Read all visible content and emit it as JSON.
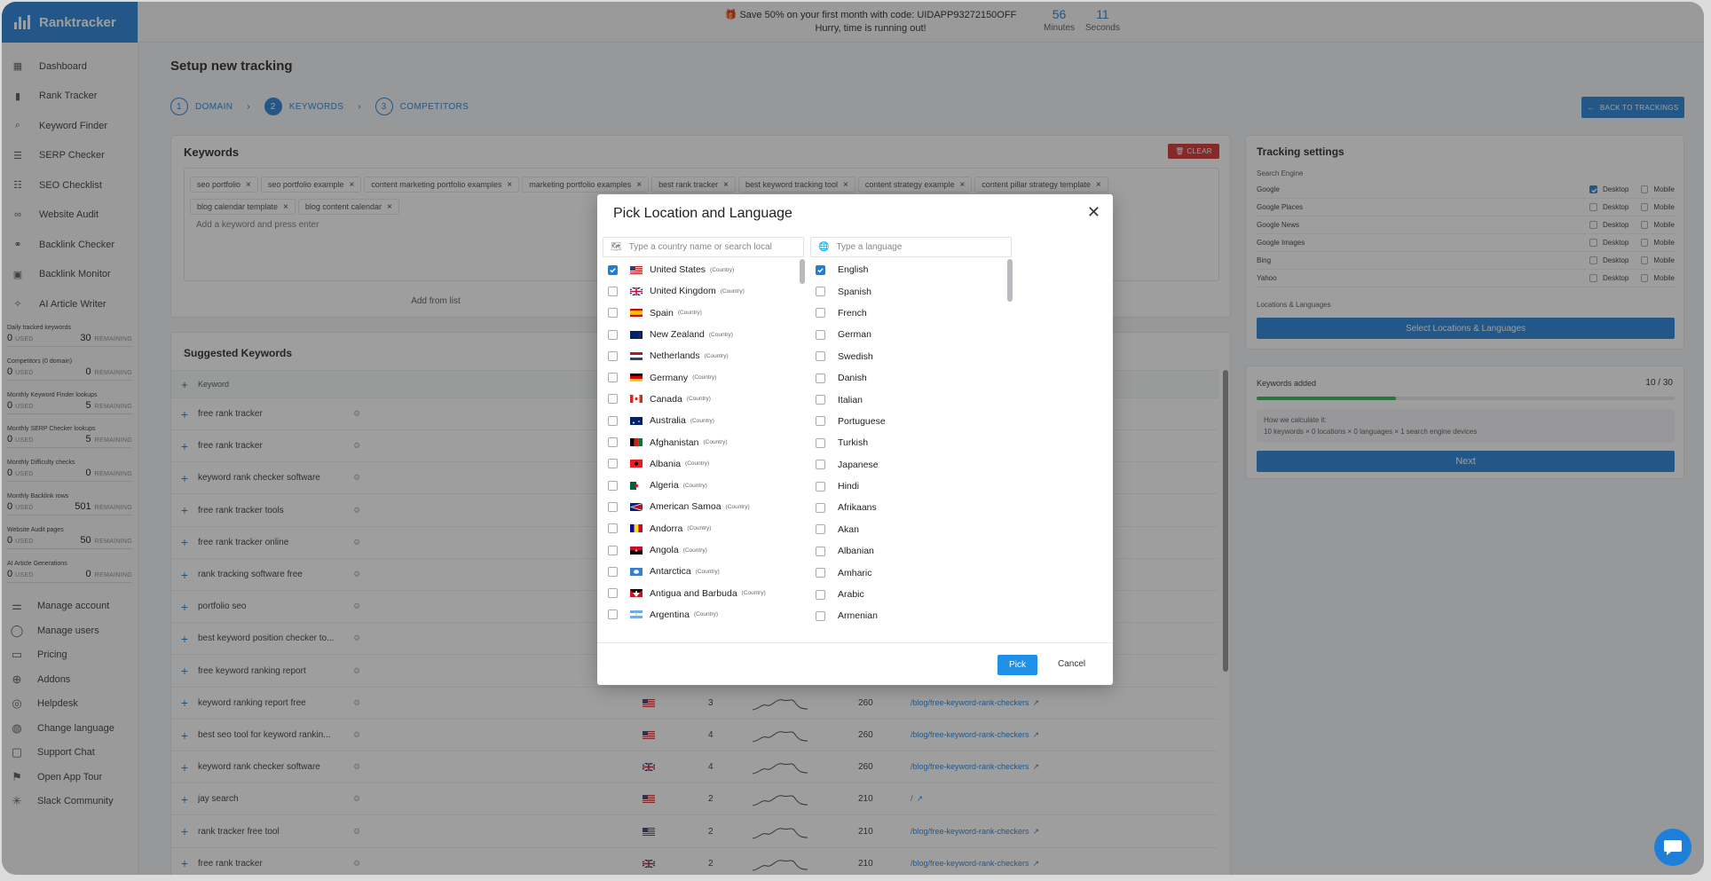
{
  "app": {
    "name": "Ranktracker",
    "brand_color": "#1e7fd8"
  },
  "banner": {
    "promo_line1": "Save 50% on your first month with code: UIDAPP93272150OFF",
    "promo_line2": "Hurry, time is running out!",
    "minutes_value": "56",
    "minutes_label": "Minutes",
    "seconds_value": "11",
    "seconds_label": "Seconds"
  },
  "sidebar": {
    "items": [
      {
        "label": "Dashboard",
        "icon": "dashboard-icon"
      },
      {
        "label": "Rank Tracker",
        "icon": "bar-chart-icon"
      },
      {
        "label": "Keyword Finder",
        "icon": "magnifier-icon"
      },
      {
        "label": "SERP Checker",
        "icon": "serp-icon"
      },
      {
        "label": "SEO Checklist",
        "icon": "checklist-icon"
      },
      {
        "label": "Website Audit",
        "icon": "binoculars-icon"
      },
      {
        "label": "Backlink Checker",
        "icon": "link-icon"
      },
      {
        "label": "Backlink Monitor",
        "icon": "monitor-icon"
      },
      {
        "label": "AI Article Writer",
        "icon": "magic-wand-icon"
      }
    ],
    "usage": [
      {
        "label": "Daily tracked keywords",
        "used": "0",
        "used_label": "USED",
        "remaining": "30",
        "remaining_label": "REMAINING"
      },
      {
        "label": "Competitors (0 domain)",
        "used": "0",
        "used_label": "USED",
        "remaining": "0",
        "remaining_label": "REMAINING"
      },
      {
        "label": "Monthly Keyword Finder lookups",
        "used": "0",
        "used_label": "USED",
        "remaining": "5",
        "remaining_label": "REMAINING"
      },
      {
        "label": "Monthly SERP Checker lookups",
        "used": "0",
        "used_label": "USED",
        "remaining": "5",
        "remaining_label": "REMAINING"
      },
      {
        "label": "Monthly Difficulty checks",
        "used": "0",
        "used_label": "USED",
        "remaining": "0",
        "remaining_label": "REMAINING"
      },
      {
        "label": "Monthly Backlink rows",
        "used": "0",
        "used_label": "USED",
        "remaining": "501",
        "remaining_label": "REMAINING"
      },
      {
        "label": "Website Audit pages",
        "used": "0",
        "used_label": "USED",
        "remaining": "50",
        "remaining_label": "REMAINING"
      },
      {
        "label": "AI Article Generations",
        "used": "0",
        "used_label": "USED",
        "remaining": "0",
        "remaining_label": "REMAINING"
      }
    ],
    "bottom_items": [
      {
        "label": "Manage account",
        "icon": "sliders-icon"
      },
      {
        "label": "Manage users",
        "icon": "user-icon"
      },
      {
        "label": "Pricing",
        "icon": "wallet-icon"
      },
      {
        "label": "Addons",
        "icon": "addons-icon"
      },
      {
        "label": "Helpdesk",
        "icon": "lifebuoy-icon"
      },
      {
        "label": "Change language",
        "icon": "globe-icon"
      },
      {
        "label": "Support Chat",
        "icon": "chat-icon"
      },
      {
        "label": "Open App Tour",
        "icon": "flag-icon"
      },
      {
        "label": "Slack Community",
        "icon": "slack-icon"
      }
    ]
  },
  "page": {
    "title": "Setup new tracking",
    "steps": [
      {
        "num": "1",
        "label": "DOMAIN"
      },
      {
        "num": "2",
        "label": "KEYWORDS"
      },
      {
        "num": "3",
        "label": "COMPETITORS"
      }
    ],
    "back_button": "BACK TO TRACKINGS"
  },
  "keywords": {
    "title": "Keywords",
    "clear_label": "CLEAR",
    "chips": [
      "seo portfolio",
      "seo portfolio example",
      "content marketing portfolio examples",
      "marketing portfolio examples",
      "best rank tracker",
      "best keyword tracking tool",
      "content strategy example",
      "content pillar strategy template",
      "blog calendar template",
      "blog content calendar"
    ],
    "placeholder": "Add a keyword and press enter",
    "add_from_list": "Add from list"
  },
  "tracking": {
    "title": "Tracking settings",
    "search_engine_label": "Search Engine",
    "desktop_label": "Desktop",
    "mobile_label": "Mobile",
    "engines": [
      {
        "name": "Google",
        "desktop": true,
        "mobile": false
      },
      {
        "name": "Google Places",
        "desktop": false,
        "mobile": false
      },
      {
        "name": "Google News",
        "desktop": false,
        "mobile": false
      },
      {
        "name": "Google Images",
        "desktop": false,
        "mobile": false
      },
      {
        "name": "Bing",
        "desktop": false,
        "mobile": false
      },
      {
        "name": "Yahoo",
        "desktop": false,
        "mobile": false
      }
    ],
    "locations_label": "Locations & Languages",
    "select_button": "Select Locations & Languages"
  },
  "added": {
    "label": "Keywords added",
    "count": "10 / 30",
    "progress": 0.333,
    "progress_color": "#2bb24c",
    "calc_title": "How we calculate it:",
    "calc_formula": "10 keywords × 0 locations × 0 languages × 1 search engine devices",
    "next_button": "Next"
  },
  "suggested": {
    "title": "Suggested Keywords",
    "column_keyword": "Keyword",
    "rows": [
      {
        "keyword": "free rank tracker"
      },
      {
        "keyword": "free rank tracker"
      },
      {
        "keyword": "keyword rank checker software"
      },
      {
        "keyword": "free rank tracker tools"
      },
      {
        "keyword": "free rank tracker online"
      },
      {
        "keyword": "rank tracking software free"
      },
      {
        "keyword": "portfolio seo"
      },
      {
        "keyword": "best keyword position checker to..."
      },
      {
        "keyword": "free keyword ranking report"
      },
      {
        "keyword": "keyword ranking report free",
        "flag": "us",
        "difficulty": "3",
        "volume": "260",
        "url": "/blog/free-keyword-rank-checkers"
      },
      {
        "keyword": "best seo tool for keyword rankin...",
        "flag": "us",
        "difficulty": "4",
        "volume": "260",
        "url": "/blog/free-keyword-rank-checkers"
      },
      {
        "keyword": "keyword rank checker software",
        "flag": "gb",
        "difficulty": "4",
        "volume": "260",
        "url": "/blog/free-keyword-rank-checkers"
      },
      {
        "keyword": "jay search",
        "flag": "us",
        "difficulty": "2",
        "volume": "210",
        "url": "/"
      },
      {
        "keyword": "rank tracker free tool",
        "flag": "us",
        "difficulty": "2",
        "volume": "210",
        "url": "/blog/free-keyword-rank-checkers"
      },
      {
        "keyword": "free rank tracker",
        "flag": "gb",
        "difficulty": "2",
        "volume": "210",
        "url": "/blog/free-keyword-rank-checkers"
      }
    ]
  },
  "modal": {
    "title": "Pick Location and Language",
    "country_placeholder": "Type a country name or search local",
    "language_placeholder": "Type a language",
    "country_tag": "(Country)",
    "countries": [
      {
        "name": "United States",
        "checked": true,
        "flag": "us"
      },
      {
        "name": "United Kingdom",
        "checked": false,
        "flag": "gb"
      },
      {
        "name": "Spain",
        "checked": false,
        "flag": "es"
      },
      {
        "name": "New Zealand",
        "checked": false,
        "flag": "nz"
      },
      {
        "name": "Netherlands",
        "checked": false,
        "flag": "nl"
      },
      {
        "name": "Germany",
        "checked": false,
        "flag": "de"
      },
      {
        "name": "Canada",
        "checked": false,
        "flag": "ca"
      },
      {
        "name": "Australia",
        "checked": false,
        "flag": "au"
      },
      {
        "name": "Afghanistan",
        "checked": false,
        "flag": "af"
      },
      {
        "name": "Albania",
        "checked": false,
        "flag": "al"
      },
      {
        "name": "Algeria",
        "checked": false,
        "flag": "dz"
      },
      {
        "name": "American Samoa",
        "checked": false,
        "flag": "as"
      },
      {
        "name": "Andorra",
        "checked": false,
        "flag": "ad"
      },
      {
        "name": "Angola",
        "checked": false,
        "flag": "ao"
      },
      {
        "name": "Antarctica",
        "checked": false,
        "flag": "aq"
      },
      {
        "name": "Antigua and Barbuda",
        "checked": false,
        "flag": "ag"
      },
      {
        "name": "Argentina",
        "checked": false,
        "flag": "ar"
      }
    ],
    "languages": [
      {
        "name": "English",
        "checked": true
      },
      {
        "name": "Spanish",
        "checked": false
      },
      {
        "name": "French",
        "checked": false
      },
      {
        "name": "German",
        "checked": false
      },
      {
        "name": "Swedish",
        "checked": false
      },
      {
        "name": "Danish",
        "checked": false
      },
      {
        "name": "Italian",
        "checked": false
      },
      {
        "name": "Portuguese",
        "checked": false
      },
      {
        "name": "Turkish",
        "checked": false
      },
      {
        "name": "Japanese",
        "checked": false
      },
      {
        "name": "Hindi",
        "checked": false
      },
      {
        "name": "Afrikaans",
        "checked": false
      },
      {
        "name": "Akan",
        "checked": false
      },
      {
        "name": "Albanian",
        "checked": false
      },
      {
        "name": "Amharic",
        "checked": false
      },
      {
        "name": "Arabic",
        "checked": false
      },
      {
        "name": "Armenian",
        "checked": false
      }
    ],
    "pick_button": "Pick",
    "cancel_button": "Cancel"
  }
}
